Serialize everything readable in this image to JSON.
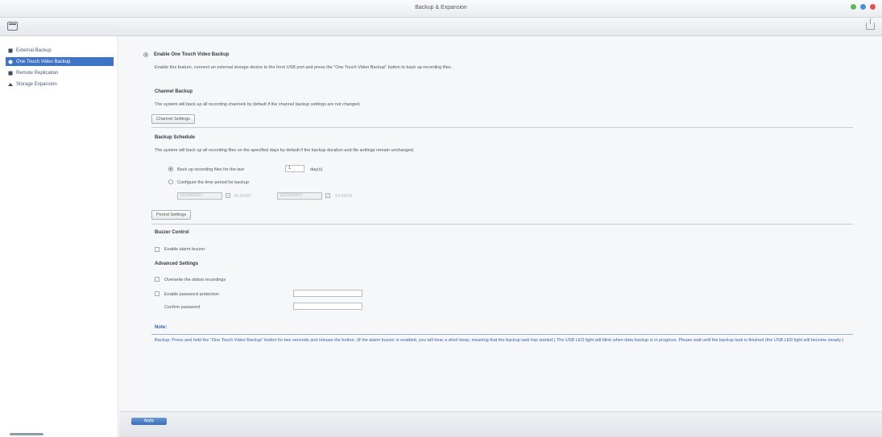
{
  "window": {
    "title": "Backup & Expansion",
    "controls_colors": [
      "#5cb85c",
      "#4a90d9",
      "#e05252"
    ]
  },
  "sidebar": {
    "items": [
      {
        "label": "External Backup",
        "icon": "external-backup-icon"
      },
      {
        "label": "One Touch Video Backup",
        "icon": "one-touch-backup-icon"
      },
      {
        "label": "Remote Replication",
        "icon": "remote-replication-icon"
      },
      {
        "label": "Storage Expansion",
        "icon": "storage-expansion-icon"
      }
    ],
    "active_index": 1
  },
  "main": {
    "enable": {
      "label": "Enable One Touch Video Backup",
      "description": "Enable this feature, connect an external storage device to the front USB port and press the \"One Touch Video Backup\" button to back up recording files."
    },
    "channel_backup": {
      "heading": "Channel Backup",
      "description": "The system will back up all recording channels by default if the channel backup settings are not changed.",
      "button": "Channel Settings"
    },
    "backup_schedule": {
      "heading": "Backup Schedule",
      "description": "The system will back up all recording files on the specified days by default if the backup duration and file settings remain unchanged.",
      "option_last": "Back up recording files for the last",
      "days_value": "1",
      "days_unit": "day(s)",
      "option_period": "Configure the time period for backup",
      "start_date": "01/16/2017",
      "start_time": "00:00:00",
      "end_date": "01/16/2017",
      "end_time": "23:59:59",
      "button": "Period Settings"
    },
    "buzzer": {
      "heading": "Buzzer Control",
      "option": "Enable alarm buzzer"
    },
    "advanced": {
      "heading": "Advanced Settings",
      "overwrite": "Overwrite the oldest recordings",
      "password": "Enable password protection",
      "confirm": "Confirm password"
    },
    "note": {
      "title": "Note:",
      "text": "Backup: Press and hold the \"One Touch Video Backup\" button for two seconds and release the button. (If the alarm buzzer is enabled, you will hear a short beep, meaning that the backup task has started.) The USB LED light will blink when data backup is in progress. Please wait until the backup task is finished (the USB LED light will become steady.)"
    }
  },
  "footer": {
    "apply_label": "Apply"
  }
}
